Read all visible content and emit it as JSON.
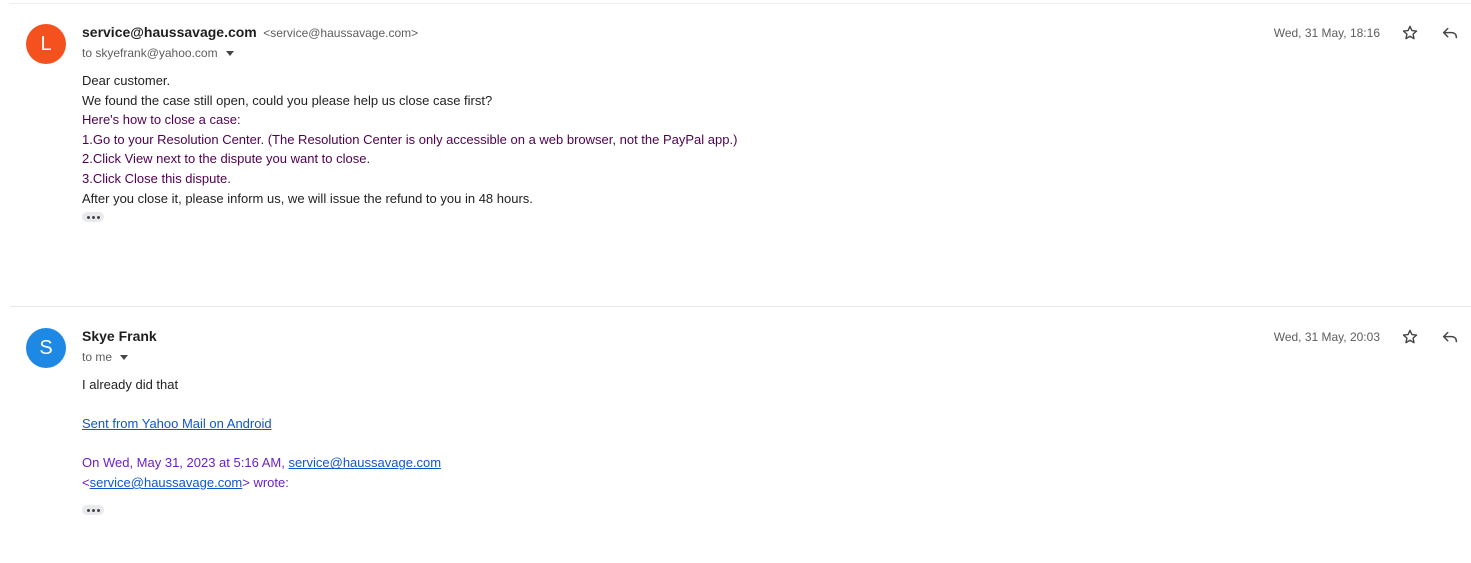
{
  "messages": [
    {
      "avatar": {
        "letter": "L",
        "color": "#f4511e"
      },
      "sender_name": "service@haussavage.com",
      "sender_email": "<service@haussavage.com>",
      "recipient": "to skyefrank@yahoo.com",
      "date": "Wed, 31 May, 18:16",
      "body": [
        {
          "text": "Dear customer.",
          "color": "#222222"
        },
        {
          "text": "We found the case still open, could you please help us close case first?",
          "color": "#222222"
        },
        {
          "text": "Here's how to close a case:",
          "color": "#500050"
        },
        {
          "text": "1.Go to your Resolution Center. (The Resolution Center is only accessible on a web browser, not the PayPal app.)",
          "color": "#500050"
        },
        {
          "text": "2.Click View next to the dispute you want to close.",
          "color": "#500050"
        },
        {
          "text": "3.Click Close this dispute.",
          "color": "#500050"
        },
        {
          "text": "After you close it, please inform us, we will issue the refund to you in 48 hours.",
          "color": "#222222"
        }
      ]
    },
    {
      "avatar": {
        "letter": "S",
        "color": "#1e88e5"
      },
      "sender_name": "Skye Frank",
      "recipient": "to me",
      "date": "Wed, 31 May, 20:03",
      "body_text": "I already did that",
      "signature_link": "Sent from Yahoo Mail on Android",
      "quote": {
        "prefix": "On Wed, May 31, 2023 at 5:16 AM,",
        "link": "service@haussavage.com",
        "open_bracket": "<",
        "link2": "service@haussavage.com",
        "suffix": "> wrote:",
        "color": "#6a1fc9"
      }
    }
  ],
  "icons": {
    "star": "star-outline-icon",
    "reply": "reply-arrow-icon",
    "more": "more-dots-icon",
    "recipient_caret": "caret-down-icon"
  }
}
